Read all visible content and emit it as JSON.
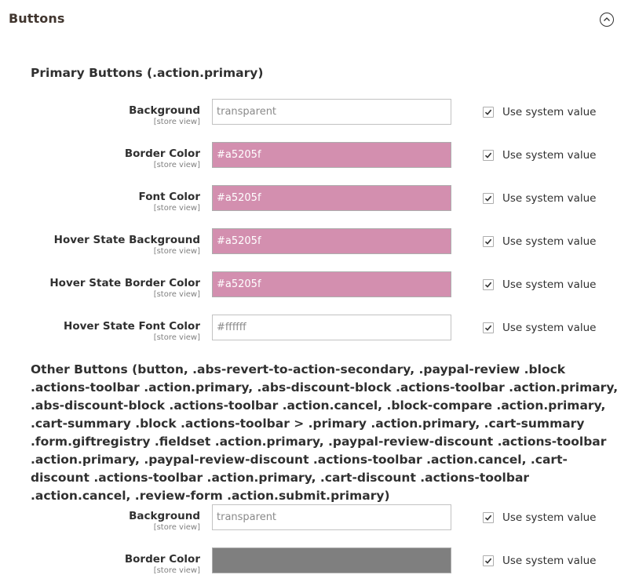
{
  "section": {
    "title": "Buttons",
    "toggle_icon": "chevron-up-circle-icon"
  },
  "primary_group": {
    "title": "Primary Buttons (.action.primary)",
    "fields": [
      {
        "label": "Background",
        "scope": "[store view]",
        "value": "transparent",
        "fill": "#ffffff",
        "use_system_label": "Use system value",
        "use_system_checked": true
      },
      {
        "label": "Border Color",
        "scope": "[store view]",
        "value": "#a5205f",
        "fill": "#d38faf",
        "use_system_label": "Use system value",
        "use_system_checked": true
      },
      {
        "label": "Font Color",
        "scope": "[store view]",
        "value": "#a5205f",
        "fill": "#d38faf",
        "use_system_label": "Use system value",
        "use_system_checked": true
      },
      {
        "label": "Hover State Background",
        "scope": "[store view]",
        "value": "#a5205f",
        "fill": "#d38faf",
        "use_system_label": "Use system value",
        "use_system_checked": true
      },
      {
        "label": "Hover State Border Color",
        "scope": "[store view]",
        "value": "#a5205f",
        "fill": "#d38faf",
        "use_system_label": "Use system value",
        "use_system_checked": true
      },
      {
        "label": "Hover State Font Color",
        "scope": "[store view]",
        "value": "#ffffff",
        "fill": "#ffffff",
        "use_system_label": "Use system value",
        "use_system_checked": true
      }
    ]
  },
  "other_group": {
    "title": "Other Buttons (button, .abs-revert-to-action-secondary, .paypal-review .block .actions-toolbar .action.primary, .abs-discount-block .actions-toolbar .action.primary, .abs-discount-block .actions-toolbar .action.cancel, .block-compare .action.primary, .cart-summary .block .actions-toolbar > .primary .action.primary, .cart-summary .form.giftregistry .fieldset .action.primary, .paypal-review-discount .actions-toolbar .action.primary, .paypal-review-discount .actions-toolbar .action.cancel, .cart-discount .actions-toolbar .action.primary, .cart-discount .actions-toolbar .action.cancel, .review-form .action.submit.primary)",
    "fields": [
      {
        "label": "Background",
        "scope": "[store view]",
        "value": "transparent",
        "fill": "#ffffff",
        "use_system_label": "Use system value",
        "use_system_checked": true
      },
      {
        "label": "Border Color",
        "scope": "[store view]",
        "value": "",
        "fill": "#7f7f7f",
        "use_system_label": "Use system value",
        "use_system_checked": true
      }
    ]
  },
  "colors": {
    "checkmark": "#303030",
    "border": "#adadad"
  }
}
